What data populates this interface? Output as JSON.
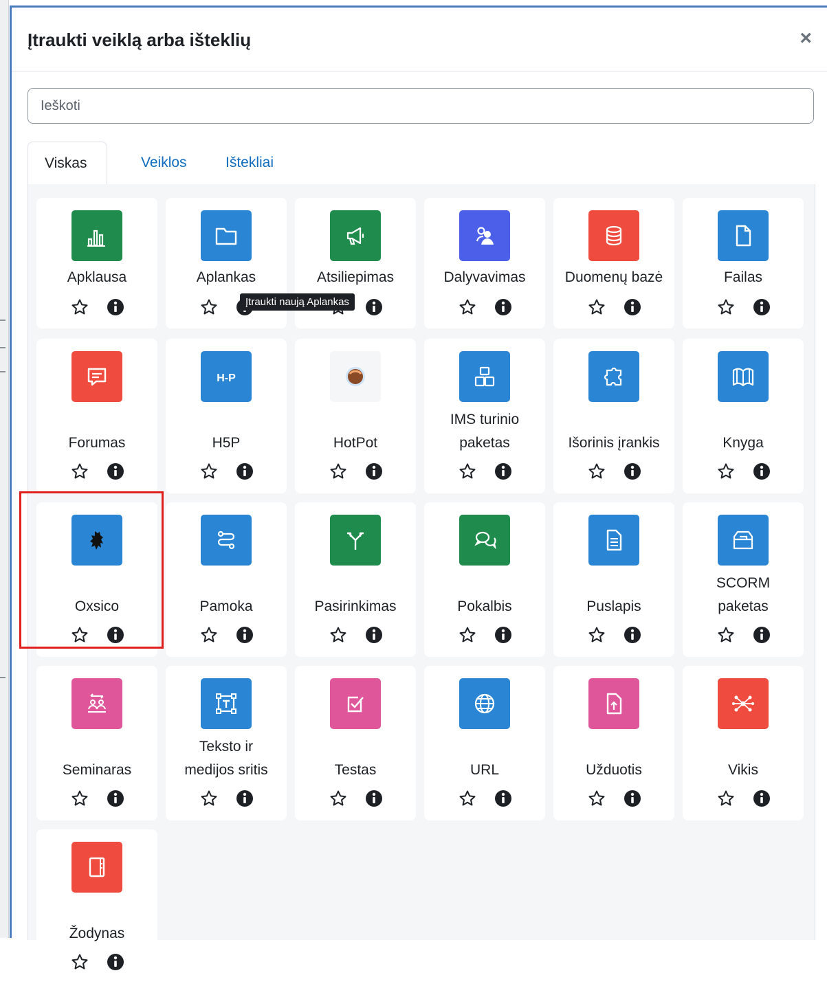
{
  "dialog": {
    "title": "Įtraukti veiklą arba išteklių",
    "close_symbol": "×"
  },
  "search": {
    "placeholder": "Ieškoti"
  },
  "tabs": [
    {
      "label": "Viskas",
      "active": true
    },
    {
      "label": "Veiklos",
      "active": false
    },
    {
      "label": "Ištekliai",
      "active": false
    }
  ],
  "tooltip": "Įtraukti naują  Aplankas",
  "modules": [
    {
      "name": "Apklausa",
      "icon": "chart-bar-icon",
      "color": "#1f8b4c"
    },
    {
      "name": "Aplankas",
      "icon": "folder-icon",
      "color": "#2a86d4"
    },
    {
      "name": "Atsiliepimas",
      "icon": "megaphone-icon",
      "color": "#1f8b4c"
    },
    {
      "name": "Dalyvavimas",
      "icon": "users-icon",
      "color": "#4c5fe8"
    },
    {
      "name": "Duomenų bazė",
      "icon": "database-icon",
      "color": "#ef4c3f"
    },
    {
      "name": "Failas",
      "icon": "file-icon",
      "color": "#2a86d4"
    },
    {
      "name": "Forumas",
      "icon": "speech-bubble-icon",
      "color": "#ef4c3f"
    },
    {
      "name": "H5P",
      "icon": "h5p-icon",
      "color": "#2a86d4"
    },
    {
      "name": "HotPot",
      "icon": "hotpot-icon",
      "color": "#f5f6f8"
    },
    {
      "name": "IMS turinio paketas",
      "icon": "package-stack-icon",
      "color": "#2a86d4"
    },
    {
      "name": "Išorinis įrankis",
      "icon": "puzzle-icon",
      "color": "#2a86d4"
    },
    {
      "name": "Knyga",
      "icon": "book-icon",
      "color": "#2a86d4"
    },
    {
      "name": "Oxsico",
      "icon": "lion-icon",
      "color": "#2a86d4"
    },
    {
      "name": "Pamoka",
      "icon": "route-icon",
      "color": "#2a86d4"
    },
    {
      "name": "Pasirinkimas",
      "icon": "fork-arrows-icon",
      "color": "#1f8b4c"
    },
    {
      "name": "Pokalbis",
      "icon": "chat-bubbles-icon",
      "color": "#1f8b4c"
    },
    {
      "name": "Puslapis",
      "icon": "page-icon",
      "color": "#2a86d4"
    },
    {
      "name": "SCORM paketas",
      "icon": "box-icon",
      "color": "#2a86d4"
    },
    {
      "name": "Seminaras",
      "icon": "workshop-icon",
      "color": "#e0569b"
    },
    {
      "name": "Teksto ir medijos sritis",
      "icon": "text-frame-icon",
      "color": "#2a86d4"
    },
    {
      "name": "Testas",
      "icon": "checkbox-icon",
      "color": "#e0569b"
    },
    {
      "name": "URL",
      "icon": "globe-icon",
      "color": "#2a86d4"
    },
    {
      "name": "Užduotis",
      "icon": "file-upload-icon",
      "color": "#e0569b"
    },
    {
      "name": "Vikis",
      "icon": "network-icon",
      "color": "#ef4c3f"
    },
    {
      "name": "Žodynas",
      "icon": "notebook-icon",
      "color": "#ef4c3f"
    }
  ]
}
